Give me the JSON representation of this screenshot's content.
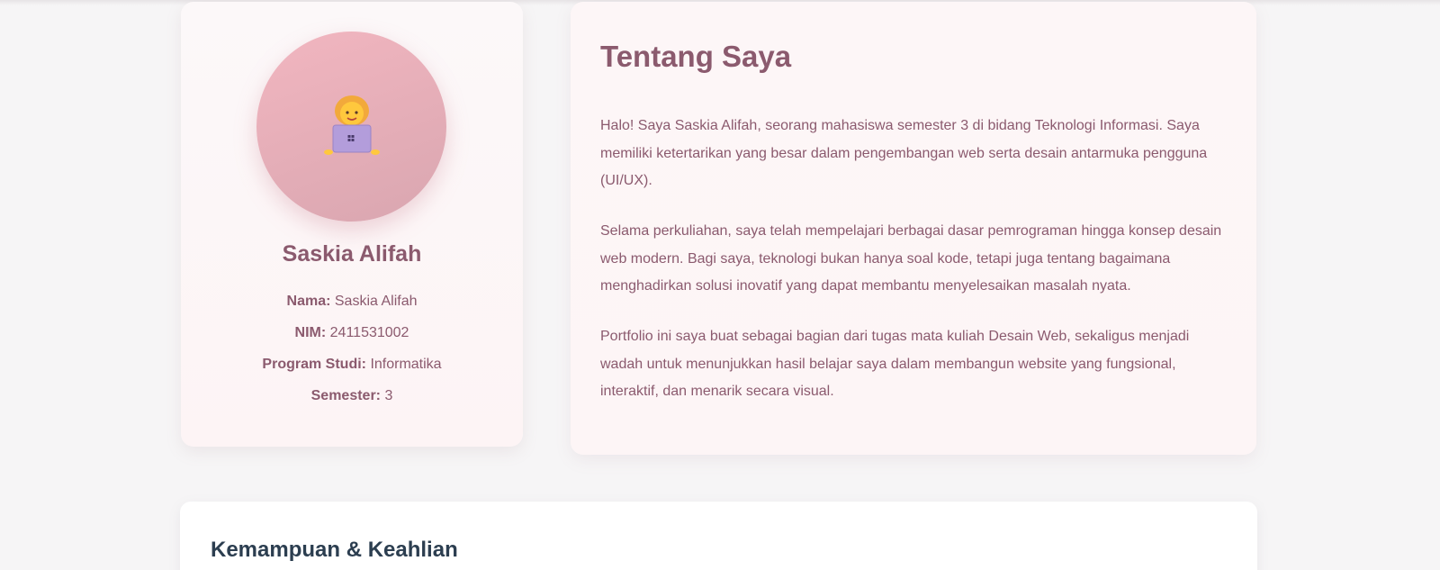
{
  "profile": {
    "avatar_icon": "woman-technologist-emoji",
    "name": "Saskia Alifah",
    "fields": [
      {
        "label": "Nama:",
        "value": "Saskia Alifah"
      },
      {
        "label": "NIM:",
        "value": "2411531002"
      },
      {
        "label": "Program Studi:",
        "value": "Informatika"
      },
      {
        "label": "Semester:",
        "value": "3"
      }
    ]
  },
  "about": {
    "title": "Tentang Saya",
    "paragraphs": [
      "Halo! Saya Saskia Alifah, seorang mahasiswa semester 3 di bidang Teknologi Informasi. Saya memiliki ketertarikan yang besar dalam pengembangan web serta desain antarmuka pengguna (UI/UX).",
      "Selama perkuliahan, saya telah mempelajari berbagai dasar pemrograman hingga konsep desain web modern. Bagi saya, teknologi bukan hanya soal kode, tetapi juga tentang bagaimana menghadirkan solusi inovatif yang dapat membantu menyelesaikan masalah nyata.",
      "Portfolio ini saya buat sebagai bagian dari tugas mata kuliah Desain Web, sekaligus menjadi wadah untuk menunjukkan hasil belajar saya dalam membangun website yang fungsional, interaktif, dan menarik secara visual."
    ]
  },
  "skills": {
    "title": "Kemampuan & Keahlian"
  },
  "colors": {
    "accent": "#8b5a6e",
    "avatar_bg": "#f2b6c0",
    "skills_title": "#2c3e50"
  }
}
